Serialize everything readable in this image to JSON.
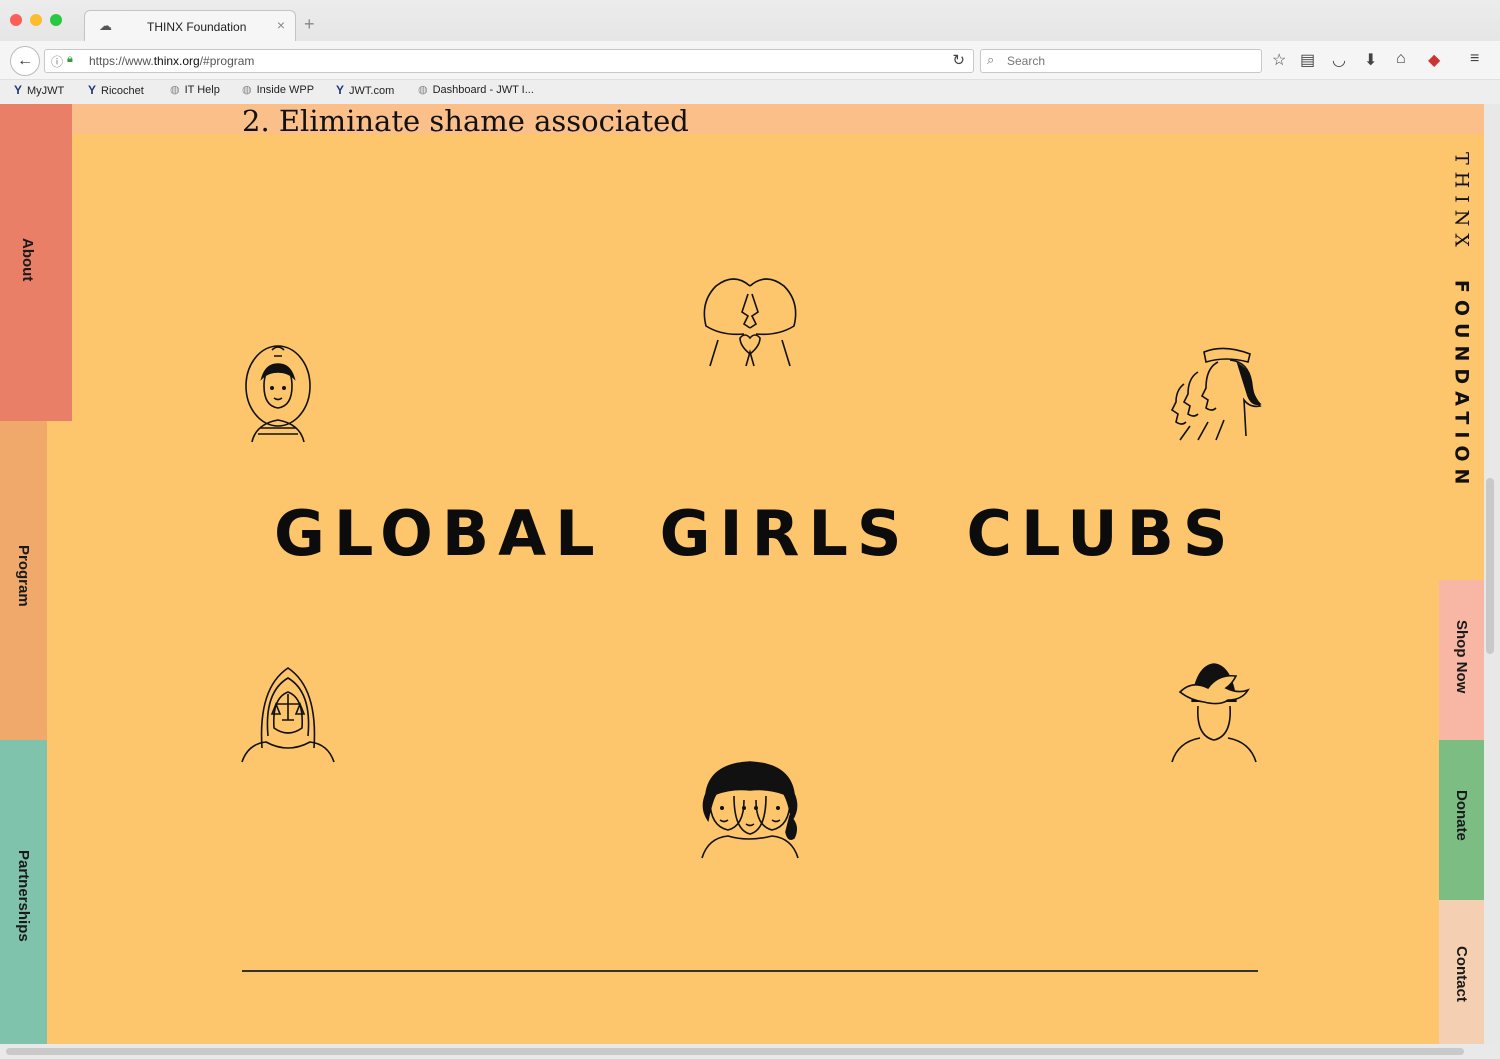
{
  "browser": {
    "tab_title": "THINX Foundation",
    "tab_close": "×",
    "new_tab": "+",
    "url_prefix": "https://www.",
    "url_domain": "thinx.org",
    "url_path": "/#program",
    "search_placeholder": "Search",
    "bookmarks": [
      {
        "label": "MyJWT",
        "icon": "jwt-logo-icon"
      },
      {
        "label": "Ricochet",
        "icon": "jwt-logo-icon"
      },
      {
        "label": "IT Help",
        "icon": "globe-icon"
      },
      {
        "label": "Inside WPP",
        "icon": "globe-icon"
      },
      {
        "label": "JWT.com",
        "icon": "jwt-logo-icon"
      },
      {
        "label": "Dashboard - JWT I...",
        "icon": "globe-icon"
      }
    ]
  },
  "page": {
    "heading": "2. Eliminate shame associated",
    "title_words": [
      "GLOBAL",
      "GIRLS",
      "CLUBS"
    ],
    "brand_thinx": "THINX",
    "brand_foundation": "FOUNDATION",
    "left_nav": [
      {
        "label": "About",
        "color": "#e97f66"
      },
      {
        "label": "Program",
        "color": "#f0a96b"
      },
      {
        "label": "Partnerships",
        "color": "#7fc3ac"
      }
    ],
    "right_nav": [
      {
        "label": "Shop Now",
        "color": "#f8b6a4"
      },
      {
        "label": "Donate",
        "color": "#7cbd83"
      },
      {
        "label": "Contact",
        "color": "#f5cfb1"
      }
    ],
    "colors": {
      "background": "#fdc56c",
      "top_band": "#fbc089",
      "text": "#111111"
    }
  }
}
